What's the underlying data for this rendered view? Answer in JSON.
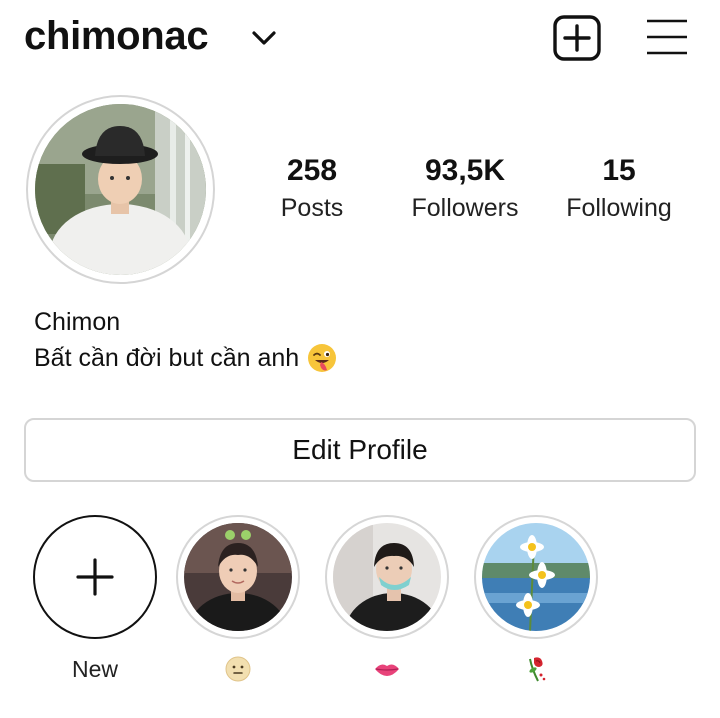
{
  "header": {
    "username": "chimonac",
    "icons": [
      "chevron-down-icon",
      "add-post-icon",
      "hamburger-menu-icon"
    ]
  },
  "profile": {
    "avatar_icon": "profile-photo",
    "stats": [
      {
        "value": "258",
        "label": "Posts"
      },
      {
        "value": "93,5K",
        "label": "Followers"
      },
      {
        "value": "15",
        "label": "Following"
      }
    ],
    "display_name": "Chimon",
    "bio": "Bất cần đời but cần anh",
    "bio_emoji": "winking-face-tongue-emoji"
  },
  "edit_button": {
    "label": "Edit Profile"
  },
  "highlights": [
    {
      "label": "New",
      "icon": "plus-icon"
    },
    {
      "label_emoji": "neutral-face-emoji"
    },
    {
      "label_emoji": "lips-emoji"
    },
    {
      "label_emoji": "wilted-rose-emoji"
    }
  ],
  "colors": {
    "text": "#111111",
    "border": "#d5d5d5",
    "background": "#ffffff"
  }
}
